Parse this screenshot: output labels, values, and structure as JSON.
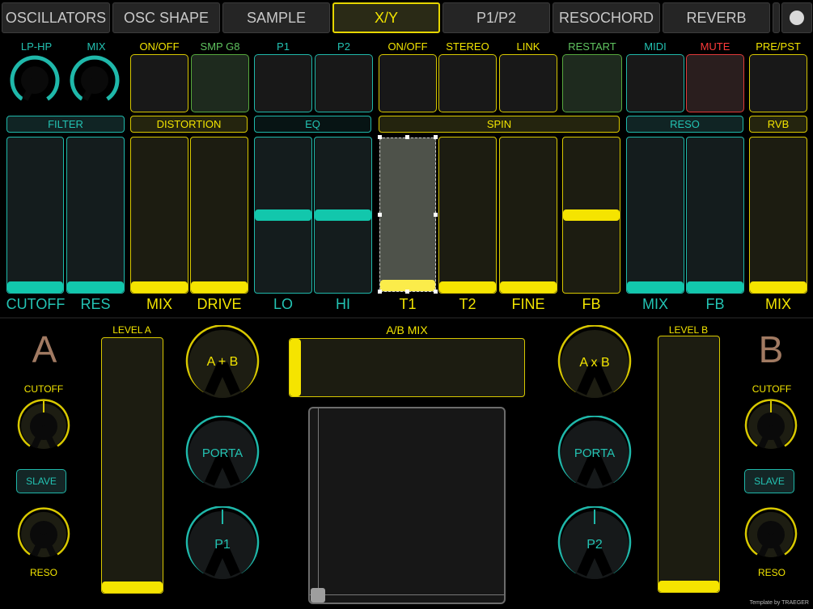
{
  "tabs": [
    "OSCILLATORS",
    "OSC SHAPE",
    "SAMPLE",
    "X/Y",
    "P1/P2",
    "RESOCHORD",
    "REVERB"
  ],
  "active_tab": "X/Y",
  "top_labels": [
    "LP-HP",
    "MIX",
    "ON/OFF",
    "SMP G8",
    "P1",
    "P2",
    "ON/OFF",
    "STEREO",
    "LINK",
    "RESTART",
    "MIDI",
    "MUTE",
    "PRE/PST"
  ],
  "sections": [
    "FILTER",
    "DISTORTION",
    "EQ",
    "SPIN",
    "RESO",
    "RVB"
  ],
  "fader_names": [
    "CUTOFF",
    "RES",
    "MIX",
    "DRIVE",
    "LO",
    "HI",
    "T1",
    "T2",
    "FINE",
    "FB",
    "MIX",
    "FB",
    "MIX"
  ],
  "fader_values": [
    0,
    0,
    0,
    0,
    0.5,
    0.5,
    0,
    0,
    0,
    0.5,
    0,
    0,
    0
  ],
  "lower": {
    "label_a": "A",
    "label_b": "B",
    "cutoff": "CUTOFF",
    "slave": "SLAVE",
    "reso": "RESO",
    "level_a": "LEVEL A",
    "level_b": "LEVEL B",
    "ab_mix": "A/B MIX",
    "a_plus_b": "A + B",
    "a_x_b": "A x B",
    "porta": "PORTA",
    "p1": "P1",
    "p2": "P2",
    "level_a_value": 0,
    "level_b_value": 0,
    "ab_mix_value": 0
  },
  "footer": "Template by TRAEGER",
  "colors": {
    "teal": "#23c3b3",
    "yellow": "#f2e400",
    "green": "#5fc35f",
    "red": "#ff3a3a"
  }
}
